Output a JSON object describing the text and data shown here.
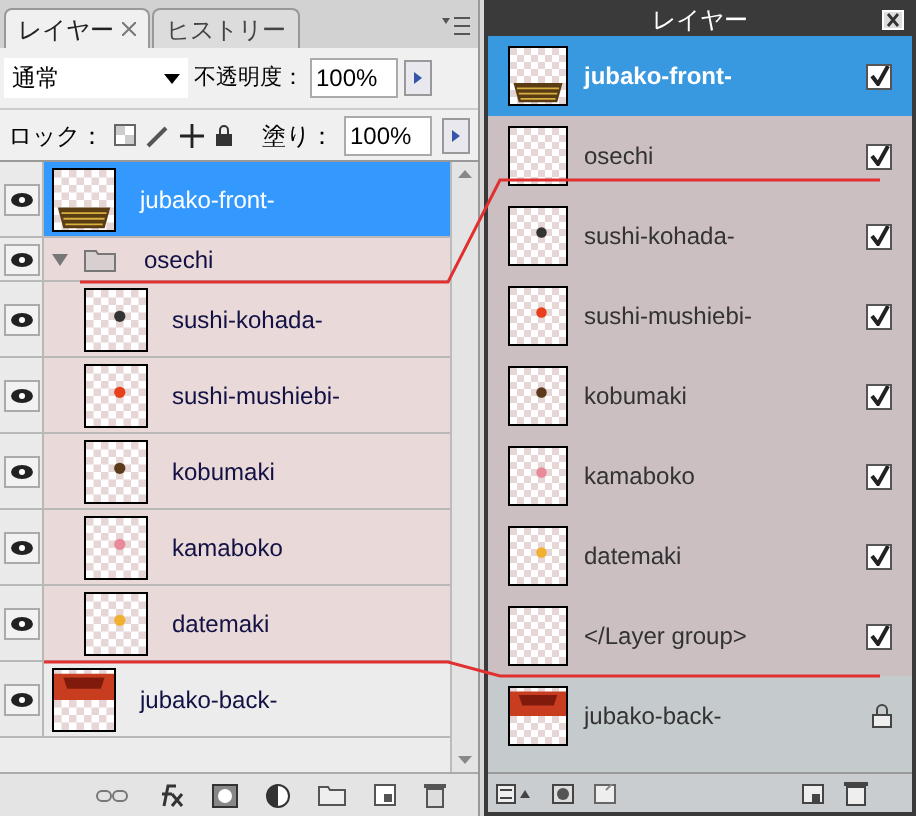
{
  "left_panel": {
    "tabs": [
      {
        "label": "レイヤー",
        "selected": true,
        "closable": true
      },
      {
        "label": "ヒストリー",
        "selected": false,
        "closable": false
      }
    ],
    "blend_mode": "通常",
    "opacity": {
      "label": "不透明度：",
      "value": "100%"
    },
    "lock": {
      "label": "ロック："
    },
    "fill": {
      "label": "塗り：",
      "value": "100%"
    },
    "layers": [
      {
        "name": "jubako-front-",
        "kind": "basket",
        "visible": true,
        "selected": true
      },
      {
        "name": "osechi",
        "kind": "group",
        "visible": true,
        "selected": false,
        "expanded": true,
        "children": [
          {
            "name": "sushi-kohada-",
            "kind": "item",
            "color": "#333333",
            "visible": true,
            "selected": false
          },
          {
            "name": "sushi-mushiebi-",
            "kind": "item",
            "color": "#e8401c",
            "visible": true,
            "selected": false
          },
          {
            "name": "kobumaki",
            "kind": "item",
            "color": "#5a3a1a",
            "visible": true,
            "selected": false
          },
          {
            "name": "kamaboko",
            "kind": "item",
            "color": "#e88a9a",
            "visible": true,
            "selected": false
          },
          {
            "name": "datemaki",
            "kind": "item",
            "color": "#f0b030",
            "visible": true,
            "selected": false
          }
        ]
      },
      {
        "name": "jubako-back-",
        "kind": "box",
        "visible": true,
        "selected": false
      }
    ]
  },
  "right_panel": {
    "title": "レイヤー",
    "layers": [
      {
        "name": "jubako-front-",
        "kind": "basket",
        "selected": true,
        "locked": false,
        "checked": true
      },
      {
        "name": "osechi",
        "kind": "blank",
        "grouped": true,
        "selected": false,
        "locked": false,
        "checked": true
      },
      {
        "name": "sushi-kohada-",
        "kind": "item",
        "color": "#333333",
        "grouped": true,
        "selected": false,
        "locked": false,
        "checked": true
      },
      {
        "name": "sushi-mushiebi-",
        "kind": "item",
        "color": "#e8401c",
        "grouped": true,
        "selected": false,
        "locked": false,
        "checked": true
      },
      {
        "name": "kobumaki",
        "kind": "item",
        "color": "#5a3a1a",
        "grouped": true,
        "selected": false,
        "locked": false,
        "checked": true
      },
      {
        "name": "kamaboko",
        "kind": "item",
        "color": "#e88a9a",
        "grouped": true,
        "selected": false,
        "locked": false,
        "checked": true
      },
      {
        "name": "datemaki",
        "kind": "item",
        "color": "#f0b030",
        "grouped": true,
        "selected": false,
        "locked": false,
        "checked": true
      },
      {
        "name": "</Layer group>",
        "kind": "blank",
        "grouped": true,
        "selected": false,
        "locked": false,
        "checked": true
      },
      {
        "name": "jubako-back-",
        "kind": "box",
        "grouped": false,
        "selected": false,
        "locked": true
      }
    ]
  }
}
